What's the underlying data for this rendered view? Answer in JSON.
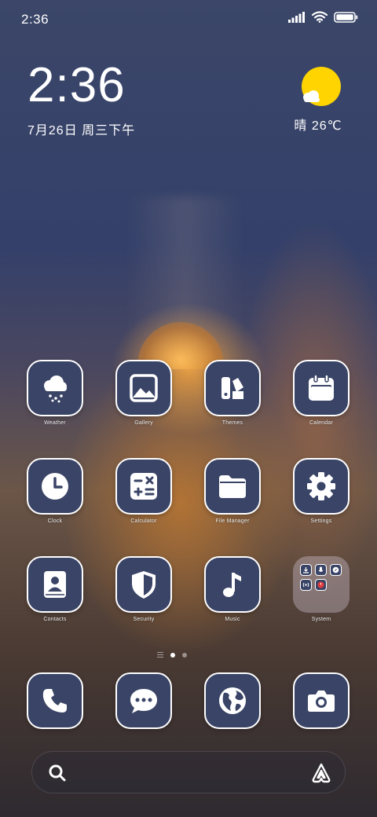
{
  "status_bar": {
    "time": "2:36",
    "icons": [
      "signal-icon",
      "wifi-icon",
      "battery-icon"
    ]
  },
  "clock_widget": {
    "time": "2:36",
    "date": "7月26日 周三下午"
  },
  "weather_widget": {
    "icon": "sunny-cloud-icon",
    "text": "晴 26℃"
  },
  "apps": [
    {
      "label": "Weather",
      "icon": "weather-icon"
    },
    {
      "label": "Gallery",
      "icon": "gallery-icon"
    },
    {
      "label": "Themes",
      "icon": "themes-icon"
    },
    {
      "label": "Calendar",
      "icon": "calendar-icon"
    },
    {
      "label": "Clock",
      "icon": "clock-icon"
    },
    {
      "label": "Calculator",
      "icon": "calculator-icon"
    },
    {
      "label": "File Manager",
      "icon": "folder-icon"
    },
    {
      "label": "Settings",
      "icon": "gear-icon"
    },
    {
      "label": "Contacts",
      "icon": "contacts-icon"
    },
    {
      "label": "Security",
      "icon": "shield-icon"
    },
    {
      "label": "Music",
      "icon": "music-note-icon"
    },
    {
      "label": "System",
      "icon": "folder-group-icon"
    }
  ],
  "dock": [
    {
      "icon": "phone-icon"
    },
    {
      "icon": "messages-icon"
    },
    {
      "icon": "browser-globe-icon"
    },
    {
      "icon": "camera-icon"
    }
  ],
  "page_indicator": {
    "pages": 2,
    "active": 1
  },
  "colors": {
    "icon_background": "#3a4466",
    "icon_border": "#ffffff",
    "sun": "#ffd400"
  }
}
